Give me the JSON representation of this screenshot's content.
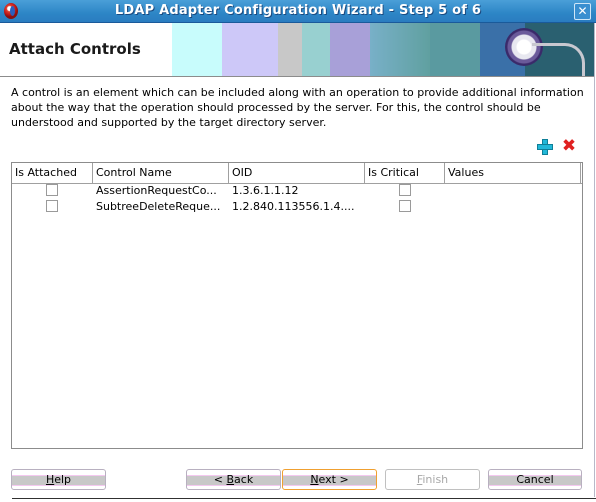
{
  "window": {
    "title": "LDAP Adapter Configuration Wizard - Step 5 of 6",
    "app_icon": "oracle-logo-icon",
    "close_icon": "close-icon",
    "close_glyph": "✕"
  },
  "header": {
    "page_title": "Attach Controls",
    "banner_icon": "gear-cable-icon"
  },
  "description": "A control is an element which can be included along with an operation to provide additional information about the way that the operation should processed by the server. For this, the control should be understood and supported by the target directory server.",
  "toolbar": {
    "add_icon": "add-icon",
    "delete_icon": "delete-icon",
    "delete_glyph": "✖"
  },
  "table": {
    "columns": [
      "Is Attached",
      "Control Name",
      "OID",
      "Is Critical",
      "Values"
    ],
    "rows": [
      {
        "is_attached": false,
        "control_name": "AssertionRequestCo...",
        "oid": "1.3.6.1.1.12",
        "is_critical": false,
        "values": ""
      },
      {
        "is_attached": false,
        "control_name": "SubtreeDeleteReque...",
        "oid": "1.2.840.113556.1.4....",
        "is_critical": false,
        "values": ""
      }
    ]
  },
  "buttons": {
    "help": {
      "mnemonic": "H",
      "rest": "elp"
    },
    "back": {
      "prefix": "< ",
      "mnemonic": "B",
      "rest": "ack"
    },
    "next": {
      "mnemonic": "N",
      "rest": "ext >"
    },
    "finish": {
      "mnemonic": "F",
      "rest": "inish",
      "enabled": false
    },
    "cancel": {
      "label": "Cancel"
    }
  },
  "colors": {
    "titlebar": "#2d86c6",
    "accent_focus": "#f0a030",
    "add_icon": "#22b8d8",
    "delete_icon": "#e02020"
  }
}
